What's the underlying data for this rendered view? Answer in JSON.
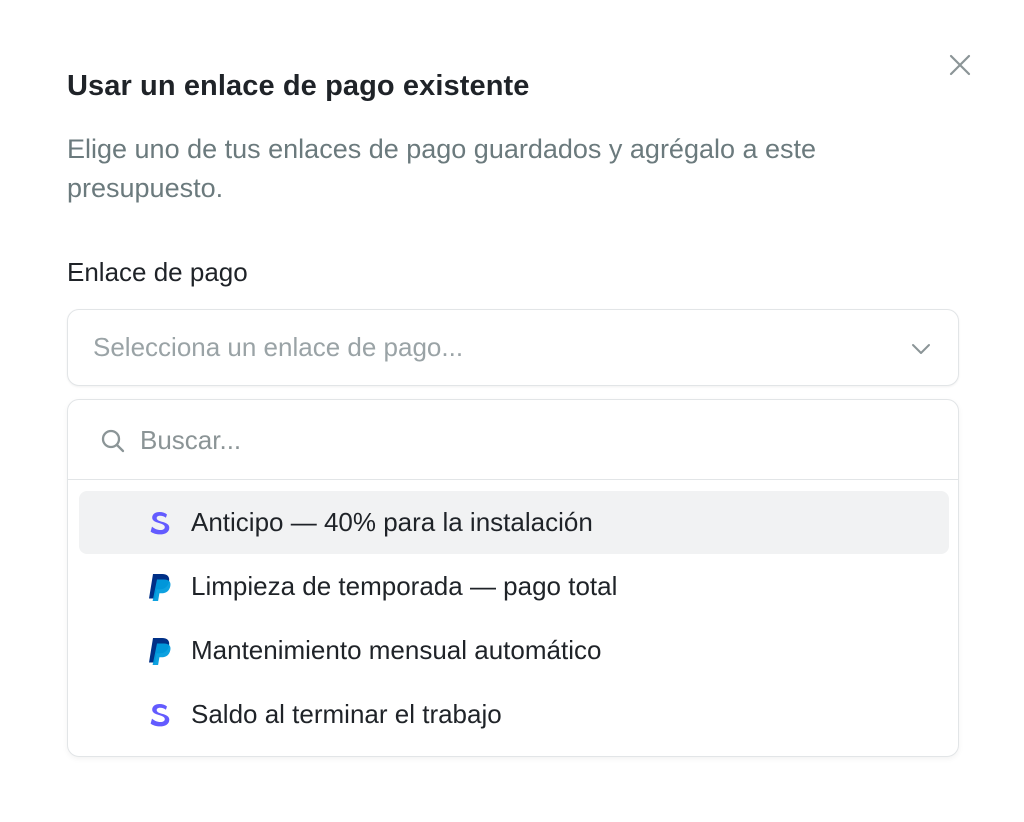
{
  "dialog": {
    "title": "Usar un enlace de pago existente",
    "description": "Elige uno de tus enlaces de pago guardados y agrégalo a este presupuesto.",
    "close_icon": "close-icon"
  },
  "field": {
    "label": "Enlace de pago",
    "placeholder": "Selecciona un enlace de pago..."
  },
  "search": {
    "placeholder": "Buscar...",
    "value": ""
  },
  "options": [
    {
      "label": "Anticipo — 40% para la instalación",
      "provider": "stripe",
      "icon": "stripe-icon",
      "active": true
    },
    {
      "label": "Limpieza de temporada — pago total",
      "provider": "paypal",
      "icon": "paypal-icon",
      "active": false
    },
    {
      "label": "Mantenimiento mensual automático",
      "provider": "paypal",
      "icon": "paypal-icon",
      "active": false
    },
    {
      "label": "Saldo al terminar el trabajo",
      "provider": "stripe",
      "icon": "stripe-icon",
      "active": false
    }
  ],
  "colors": {
    "stripe": "#635bff",
    "paypal_dark": "#003087",
    "paypal_light": "#009cde",
    "highlight": "#f1f2f3"
  }
}
